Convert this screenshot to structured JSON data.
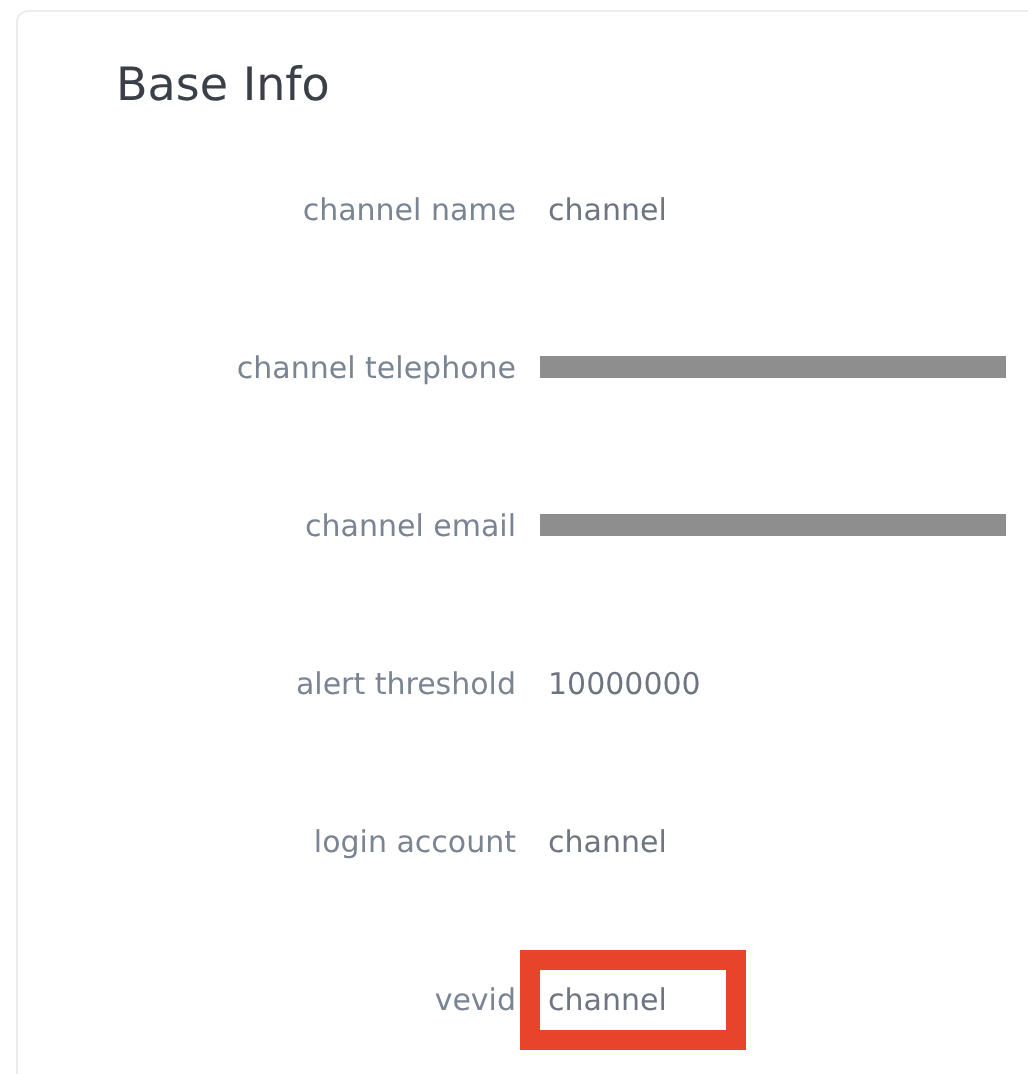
{
  "section": {
    "title": "Base Info"
  },
  "fields": [
    {
      "label": "channel name",
      "value": "channel",
      "redacted": false,
      "highlighted": false
    },
    {
      "label": "channel telephone",
      "redacted": true,
      "highlighted": false
    },
    {
      "label": "channel email",
      "redacted": true,
      "highlighted": false
    },
    {
      "label": "alert threshold",
      "value": "10000000",
      "redacted": false,
      "highlighted": false
    },
    {
      "label": "login account",
      "value": "channel",
      "redacted": false,
      "highlighted": false
    },
    {
      "label": "vevid",
      "value": "channel",
      "redacted": false,
      "highlighted": true
    }
  ]
}
